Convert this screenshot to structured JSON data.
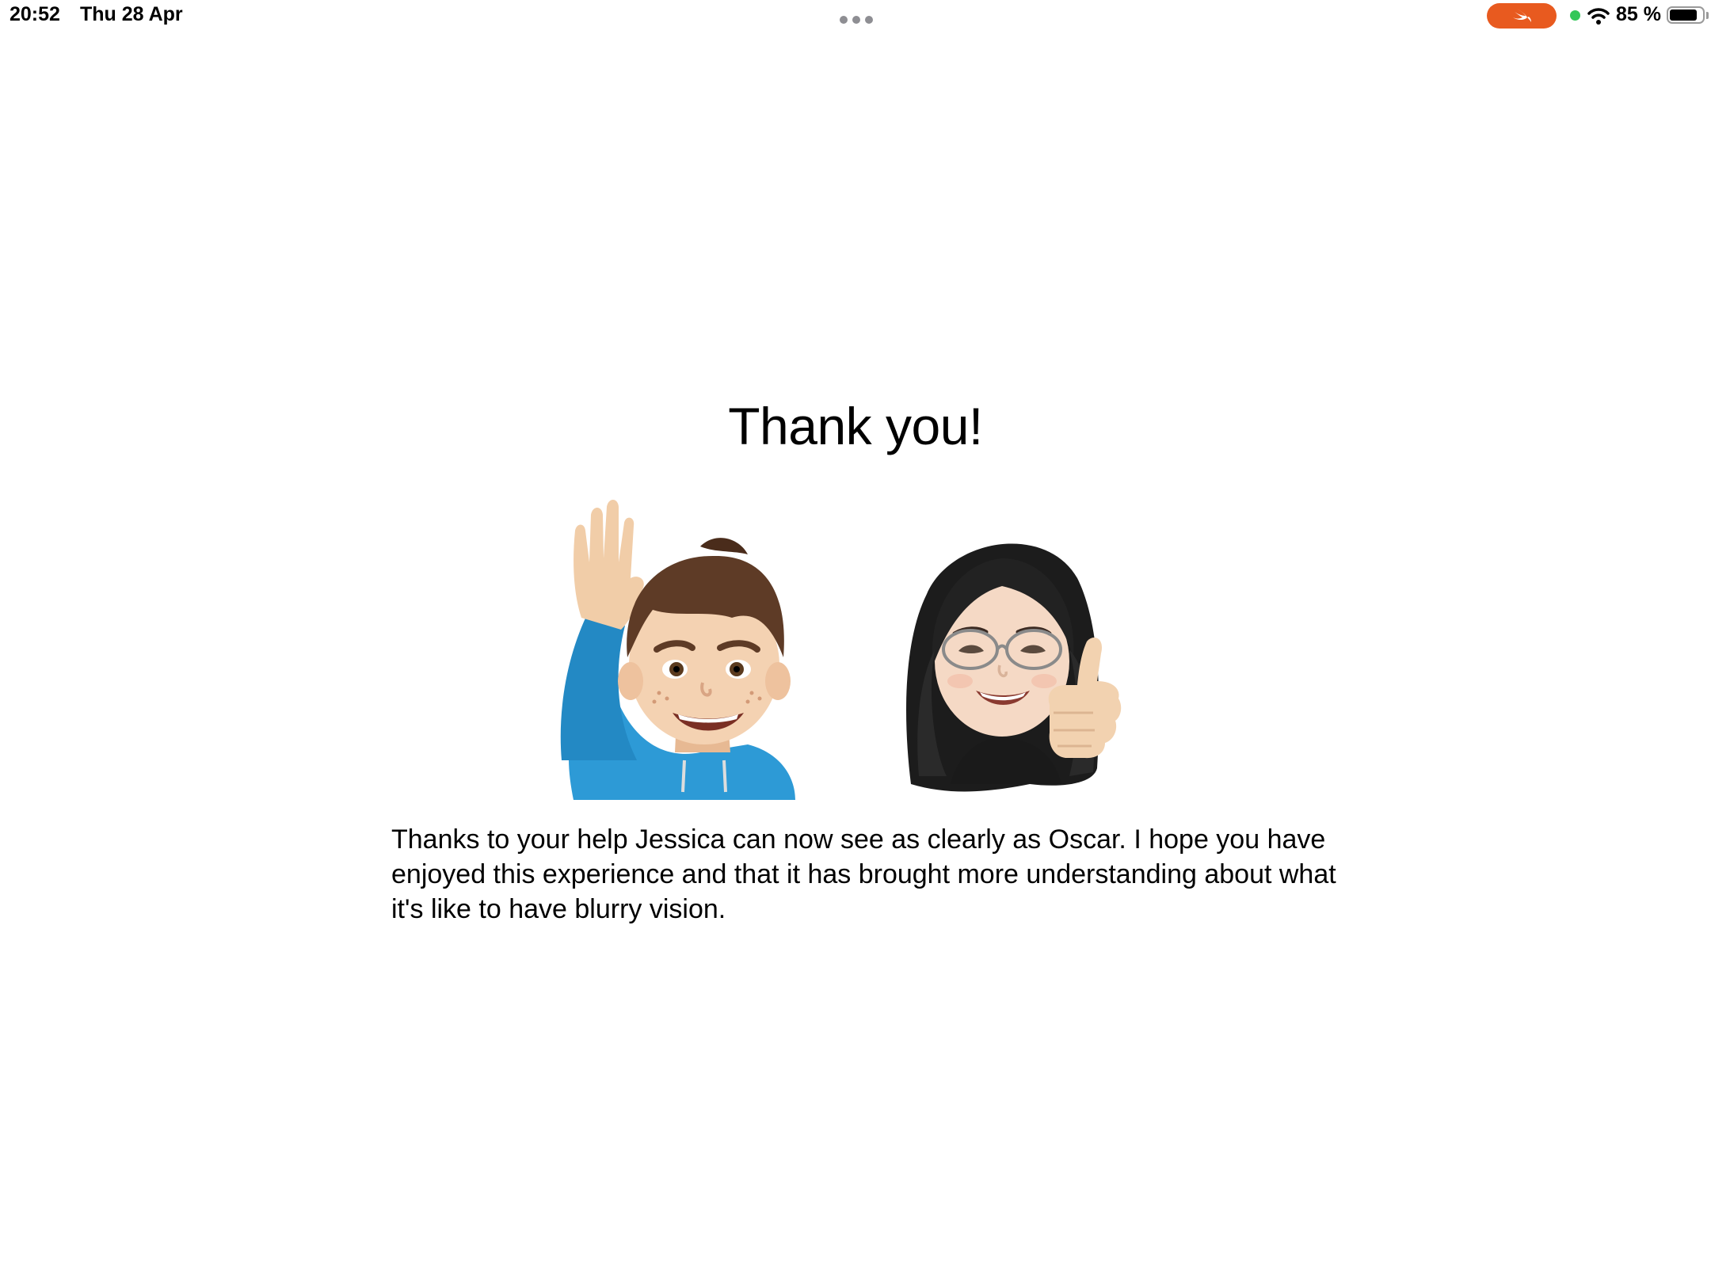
{
  "status_bar": {
    "time": "20:52",
    "date": "Thu 28 Apr",
    "battery_percent": "85 %",
    "battery_level": 0.85,
    "swift_color": "#e85a1f",
    "indicator_color": "#33c759"
  },
  "main": {
    "title": "Thank you!",
    "message": "Thanks to your help Jessica can now see as clearly as Oscar. I hope you have enjoyed this experience and that it has brought more understanding about what it's like to have blurry vision.",
    "avatars": [
      {
        "name": "Oscar",
        "icon": "waving-boy-memoji-icon"
      },
      {
        "name": "Jessica",
        "icon": "thumbs-up-girl-memoji-icon"
      }
    ]
  }
}
